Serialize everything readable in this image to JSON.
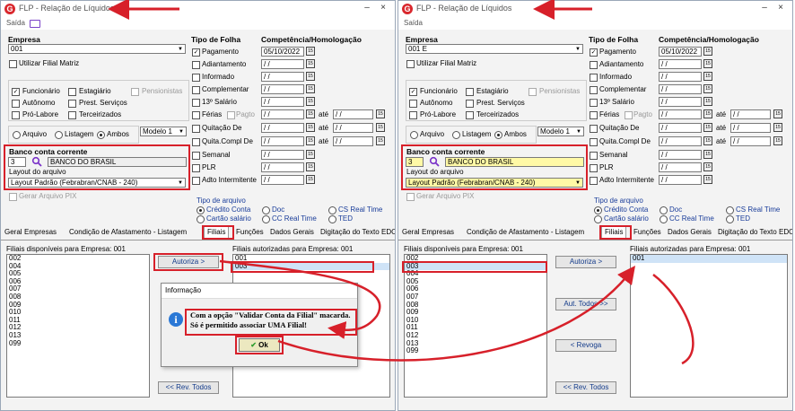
{
  "app": {
    "title": "FLP - Relação de Líquidos",
    "logo_letter": "G",
    "menu_saida": "Saída",
    "minimize": "–",
    "close": "×"
  },
  "empresa": {
    "label": "Empresa",
    "value_left": "001",
    "value_right": "001 E",
    "utilizar_filial_matriz": "Utilizar Filial Matriz"
  },
  "tipos": {
    "funcionario": "Funcionário",
    "estagiario": "Estagiário",
    "pensionistas": "Pensionistas",
    "autonomo": "Autônomo",
    "prest_servicos": "Prest. Serviços",
    "pro_labore": "Pró-Labore",
    "terceirizados": "Terceirizados"
  },
  "saida_tipo": {
    "arquivo": "Arquivo",
    "listagem": "Listagem",
    "ambos": "Ambos",
    "modelo": "Modelo 1"
  },
  "banco": {
    "label": "Banco conta corrente",
    "code": "3",
    "name": "BANCO DO BRASIL"
  },
  "layout": {
    "label": "Layout do arquivo",
    "value": "Layout Padrão (Febrabran/CNAB - 240)",
    "gerar_pix": "Gerar Arquivo PIX"
  },
  "folha": {
    "header_tipo": "Tipo de Folha",
    "header_comp": "Competência/Homologação",
    "items": [
      "Pagamento",
      "Adiantamento",
      "Informado",
      "Complementar",
      "13º Salário",
      "Férias",
      "Quitação De",
      "Quita.Compl De",
      "Semanal",
      "PLR",
      "Adto Intermitente"
    ],
    "pagto": "Pagto",
    "ate": "até",
    "date_pagamento": "05/10/2022",
    "date_empty": "/ /"
  },
  "tipo_arquivo": {
    "label": "Tipo de arquivo",
    "credito_conta": "Crédito Conta",
    "doc": "Doc",
    "cs_real_time": "CS Real Time",
    "cartao_salario": "Cartão salário",
    "cc_real_time": "CC Real Time",
    "ted": "TED"
  },
  "tabs": [
    "Geral",
    "Empresas",
    "Condição de Afastamento - Listagem",
    "Filiais",
    "Funções",
    "Dados Gerais",
    "Digitação do Texto",
    "EDO"
  ],
  "filiais": {
    "disponiveis_label": "Filiais disponíveis para Empresa: 001",
    "autorizadas_label": "Filiais autorizadas para Empresa: 001",
    "left_available": [
      "002",
      "004",
      "005",
      "006",
      "007",
      "008",
      "009",
      "010",
      "011",
      "012",
      "013",
      "099"
    ],
    "left_authorized": [
      "001",
      "003"
    ],
    "right_available": [
      "002",
      "003",
      "004",
      "005",
      "006",
      "007",
      "008",
      "009",
      "010",
      "011",
      "012",
      "013",
      "099"
    ],
    "right_authorized": [
      "001"
    ],
    "autoriza": "Autoriza >",
    "aut_todos": "Aut. Todos >>",
    "revoga": "< Revoga",
    "rev_todos": "<< Rev. Todos"
  },
  "dialog": {
    "title": "Informação",
    "icon": "i",
    "line1": "Com a opção \"Validar Conta da Filial\" macarda.",
    "line2": "Só é permitido associar UMA Filial!",
    "ok": "Ok",
    "check": "✔"
  },
  "colors": {
    "accent_red": "#d7202a",
    "highlight_yellow": "#fff9a6",
    "dialog_blue": "#2a78d6"
  }
}
